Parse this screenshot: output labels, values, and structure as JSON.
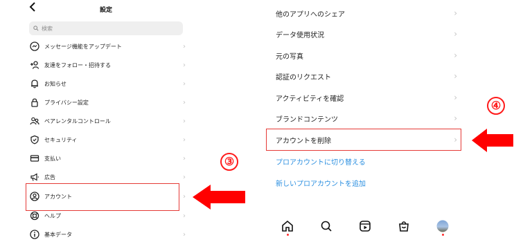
{
  "left": {
    "back_icon": "chevron-left-icon",
    "title": "設定",
    "search_placeholder": "検索",
    "items": [
      {
        "label": "メッセージ機能をアップデート",
        "icon": "messenger-icon"
      },
      {
        "label": "友達をフォロー・招待する",
        "icon": "add-person-icon"
      },
      {
        "label": "お知らせ",
        "icon": "bell-icon"
      },
      {
        "label": "プライバシー設定",
        "icon": "lock-icon"
      },
      {
        "label": "ペアレンタルコントロール",
        "icon": "people-icon"
      },
      {
        "label": "セキュリティ",
        "icon": "shield-icon"
      },
      {
        "label": "支払い",
        "icon": "card-icon"
      },
      {
        "label": "広告",
        "icon": "megaphone-icon"
      },
      {
        "label": "アカウント",
        "icon": "account-circle-icon"
      },
      {
        "label": "ヘルプ",
        "icon": "lifebuoy-icon"
      },
      {
        "label": "基本データ",
        "icon": "info-icon"
      }
    ],
    "step_marker": "③"
  },
  "right": {
    "items": [
      {
        "label": "他のアプリへのシェア"
      },
      {
        "label": "データ使用状況"
      },
      {
        "label": "元の写真"
      },
      {
        "label": "認証のリクエスト"
      },
      {
        "label": "アクティビティを確認"
      },
      {
        "label": "ブランドコンテンツ"
      },
      {
        "label": "アカウントを削除"
      }
    ],
    "links": [
      "プロアカウントに切り替える",
      "新しいプロアカウントを追加"
    ],
    "nav": [
      "home-icon",
      "search-icon",
      "reels-icon",
      "shop-icon",
      "profile-avatar"
    ],
    "step_marker": "④"
  },
  "colors": {
    "highlight": "#e53935",
    "arrow": "#ff0000",
    "link": "#2b8fe0"
  }
}
